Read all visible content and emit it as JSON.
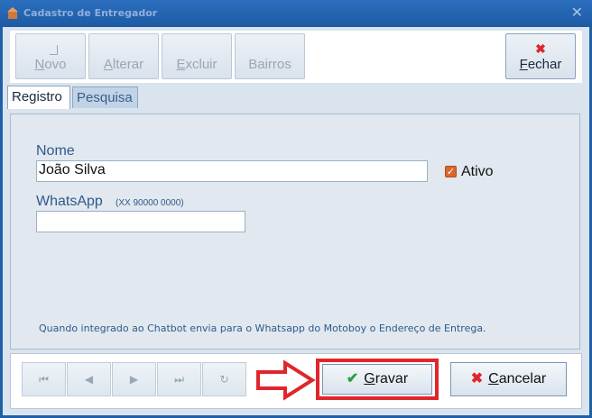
{
  "window": {
    "title": "Cadastro de Entregador",
    "close_glyph": "✕"
  },
  "toolbar": {
    "novo": {
      "label": "Novo",
      "underline": "N",
      "rest": "ovo"
    },
    "alterar": {
      "label": "Alterar",
      "underline": "A",
      "rest": "lterar"
    },
    "excluir": {
      "label": "Excluir",
      "underline": "E",
      "rest": "xcluir"
    },
    "bairros": {
      "label": "Bairros"
    },
    "fechar": {
      "label": "Fechar",
      "underline": "F",
      "rest": "echar",
      "icon": "✖"
    }
  },
  "tabs": [
    {
      "label": "Registro"
    },
    {
      "label": "Pesquisa"
    }
  ],
  "form": {
    "nome_label": "Nome",
    "nome_value": "João Silva",
    "ativo_label": "Ativo",
    "ativo_checked": true,
    "whatsapp_label": "WhatsApp",
    "whatsapp_hint": "(XX 90000 0000)",
    "whatsapp_value": "",
    "footer_note": "Quando integrado ao Chatbot envia para o Whatsapp do Motoboy o Endereço de Entrega."
  },
  "nav": {
    "first": "⏮",
    "prev": "◀",
    "next": "▶",
    "last": "⏭",
    "refresh": "↻"
  },
  "actions": {
    "gravar": {
      "underline": "G",
      "rest": "ravar",
      "icon": "✔"
    },
    "cancelar": {
      "underline": "C",
      "rest": "ancelar",
      "icon": "✖"
    }
  },
  "colors": {
    "accent_red": "#e0262c",
    "titlebar": "#1f5fa8",
    "label_blue": "#2f5a8a"
  }
}
